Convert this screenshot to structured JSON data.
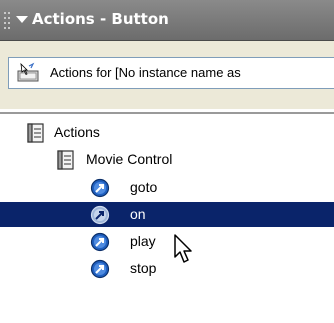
{
  "panel": {
    "title": "Actions - Button",
    "target_label": "Actions for [No instance name as"
  },
  "tree": {
    "items": [
      {
        "label": "Actions",
        "type": "book",
        "level": 0,
        "selected": false
      },
      {
        "label": "Movie Control",
        "type": "book",
        "level": 1,
        "selected": false
      },
      {
        "label": "goto",
        "type": "action",
        "level": 2,
        "selected": false
      },
      {
        "label": "on",
        "type": "action",
        "level": 2,
        "selected": true
      },
      {
        "label": "play",
        "type": "action",
        "level": 2,
        "selected": false
      },
      {
        "label": "stop",
        "type": "action",
        "level": 2,
        "selected": false
      }
    ]
  },
  "colors": {
    "titlebar": "#7a7a7a",
    "selection": "#0a246a",
    "action_icon": "#1f5fbf"
  },
  "icons": {
    "title_arrow": "collapse-arrow-icon",
    "target": "button-target-icon",
    "book": "book-icon",
    "action": "action-arrow-icon",
    "cursor": "mouse-pointer-icon"
  }
}
